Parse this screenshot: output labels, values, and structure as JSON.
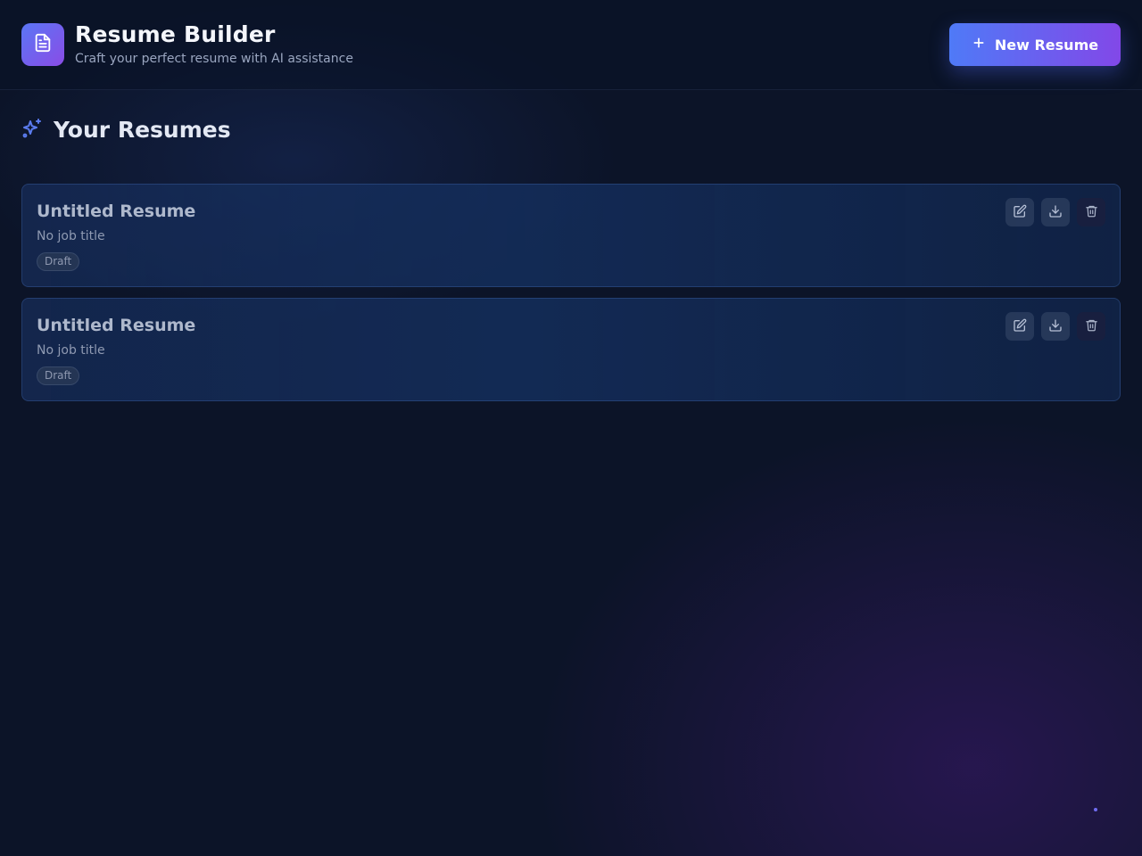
{
  "header": {
    "app_title": "Resume Builder",
    "app_subtitle": "Craft your perfect resume with AI assistance",
    "logo_icon": "document-icon",
    "new_button_label": "New Resume",
    "new_button_icon": "plus-icon"
  },
  "section": {
    "title": "Your Resumes",
    "icon": "sparkles-icon"
  },
  "resumes": [
    {
      "title": "Untitled Resume",
      "job_title": "No job title",
      "status": "Draft",
      "actions": [
        "edit-icon",
        "download-icon",
        "trash-icon"
      ]
    },
    {
      "title": "Untitled Resume",
      "job_title": "No job title",
      "status": "Draft",
      "actions": [
        "edit-icon",
        "download-icon",
        "trash-icon"
      ]
    }
  ],
  "colors": {
    "accent_start": "#4f7af7",
    "accent_end": "#8248e8",
    "background": "#0c1428"
  }
}
